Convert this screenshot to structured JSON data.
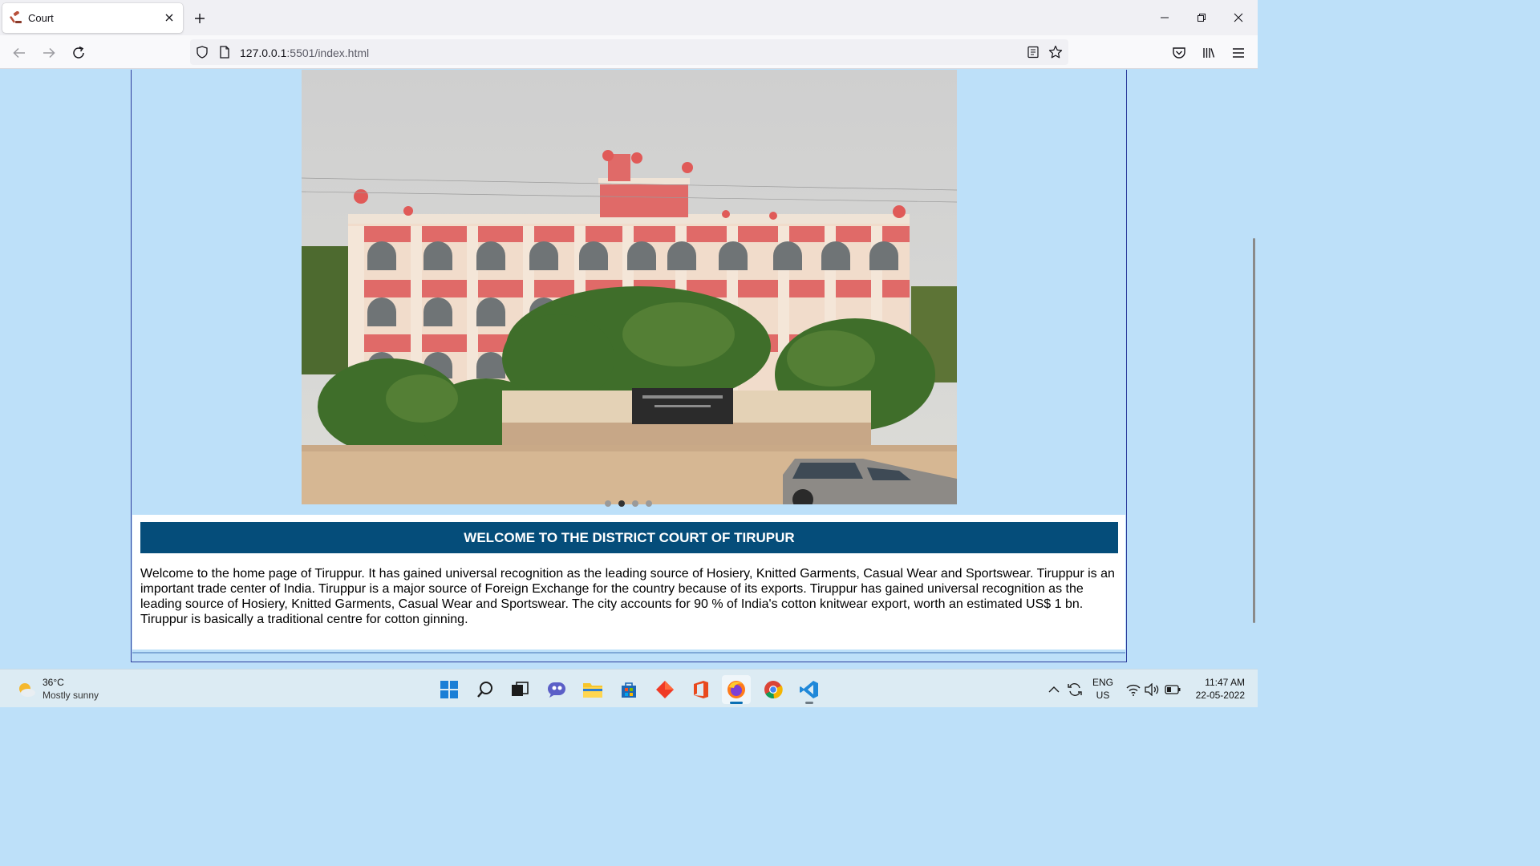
{
  "browser": {
    "tab": {
      "title": "Court"
    },
    "url": {
      "host": "127.0.0.1",
      "rest": ":5501/index.html"
    }
  },
  "page": {
    "carousel": {
      "slide_count": 4,
      "active_index": 1
    },
    "welcome_heading": "WELCOME TO THE DISTRICT COURT OF TIRUPUR",
    "welcome_text": "Welcome to the home page of Tiruppur. It has gained universal recognition as the leading source of Hosiery, Knitted Garments, Casual Wear and Sportswear. Tiruppur is an important trade center of India. Tiruppur is a major source of Foreign Exchange for the country because of its exports. Tiruppur has gained universal recognition as the leading source of Hosiery, Knitted Garments, Casual Wear and Sportswear. The city accounts for 90 % of India's cotton knitwear export, worth an estimated US$ 1 bn. Tiruppur is basically a traditional centre for cotton ginning."
  },
  "taskbar": {
    "weather": {
      "temp": "36°C",
      "condition": "Mostly sunny"
    },
    "apps": [
      "start-icon",
      "search-icon",
      "task-view-icon",
      "chat-icon",
      "file-explorer-icon",
      "store-icon",
      "app-icon",
      "office-icon",
      "firefox-icon",
      "chrome-icon",
      "vscode-icon"
    ],
    "language": {
      "line1": "ENG",
      "line2": "US"
    },
    "clock": {
      "time": "11:47 AM",
      "date": "22-05-2022"
    }
  },
  "colors": {
    "page_bg": "#bde0f9",
    "banner_bg": "#054d7a",
    "border": "#2b3c9c"
  }
}
